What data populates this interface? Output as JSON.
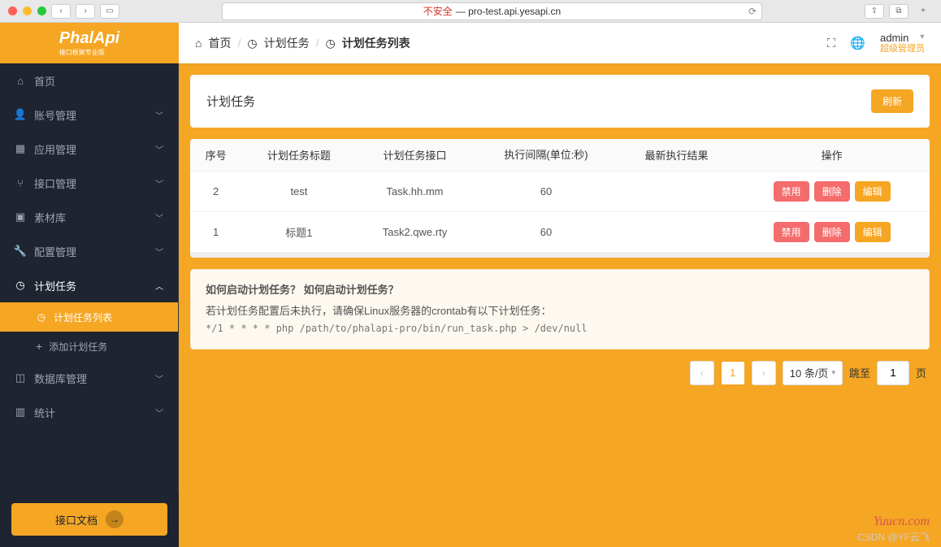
{
  "browser": {
    "insecure_label": "不安全",
    "url": " — pro-test.api.yesapi.cn"
  },
  "logo": {
    "text": "PhalApi",
    "sub": "接口框架专业版"
  },
  "sidebar": {
    "items": [
      {
        "icon": "home",
        "label": "首页",
        "expandable": false
      },
      {
        "icon": "person",
        "label": "账号管理",
        "expandable": true
      },
      {
        "icon": "grid",
        "label": "应用管理",
        "expandable": true
      },
      {
        "icon": "branch",
        "label": "接口管理",
        "expandable": true
      },
      {
        "icon": "image",
        "label": "素材库",
        "expandable": true
      },
      {
        "icon": "wrench",
        "label": "配置管理",
        "expandable": true
      },
      {
        "icon": "clock",
        "label": "计划任务",
        "expandable": true,
        "active": true
      },
      {
        "icon": "db",
        "label": "数据库管理",
        "expandable": true
      },
      {
        "icon": "chart",
        "label": "统计",
        "expandable": true
      }
    ],
    "submenu": [
      {
        "icon": "clock",
        "label": "计划任务列表",
        "selected": true
      },
      {
        "icon": "plus",
        "label": "添加计划任务",
        "selected": false
      }
    ],
    "doc_button": "接口文档"
  },
  "breadcrumb": {
    "home": "首页",
    "parent": "计划任务",
    "current": "计划任务列表"
  },
  "topbar": {
    "user_name": "admin",
    "user_role": "超级管理员"
  },
  "header": {
    "title": "计划任务",
    "refresh": "刷新"
  },
  "table": {
    "columns": [
      "序号",
      "计划任务标题",
      "计划任务接口",
      "执行间隔(单位:秒)",
      "最新执行结果",
      "操作"
    ],
    "rows": [
      {
        "seq": "2",
        "title": "test",
        "api": "Task.hh.mm",
        "interval": "60",
        "result": ""
      },
      {
        "seq": "1",
        "title": "标题1",
        "api": "Task2.qwe.rty",
        "interval": "60",
        "result": ""
      }
    ],
    "actions": {
      "disable": "禁用",
      "delete": "删除",
      "edit": "编辑"
    }
  },
  "info": {
    "title": "如何启动计划任务？ 如何启动计划任务？",
    "line1": "若计划任务配置后未执行，请确保Linux服务器的crontab有以下计划任务：",
    "line2": "*/1 * * * * php /path/to/phalapi-pro/bin/run_task.php > /dev/null"
  },
  "pagination": {
    "current": "1",
    "per_page": "10 条/页",
    "jump_label": "跳至",
    "jump_value": "1",
    "page_suffix": "页"
  },
  "watermark": "Yuucn.com",
  "csdn": "CSDN @YF云飞"
}
